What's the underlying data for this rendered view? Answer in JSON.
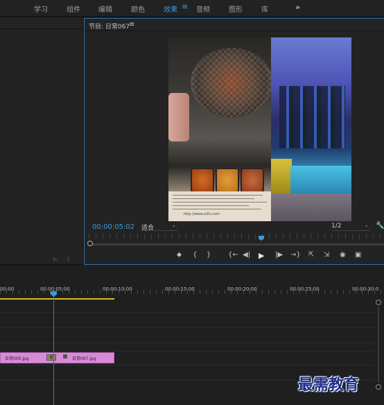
{
  "workspaces": [
    {
      "label": "学习",
      "active": false
    },
    {
      "label": "组件",
      "active": false
    },
    {
      "label": "编辑",
      "active": false
    },
    {
      "label": "颜色",
      "active": false
    },
    {
      "label": "效果",
      "active": true
    },
    {
      "label": "音频",
      "active": false
    },
    {
      "label": "图形",
      "active": false
    },
    {
      "label": "库",
      "active": false
    }
  ],
  "workspace_menu_icon": "≡",
  "workspace_more": "»",
  "program_monitor": {
    "title": "节目: 日常067",
    "menu_icon": "≡",
    "timecode": "00:00:05:02",
    "fit_label": "适合",
    "resolution_label": "1/2",
    "paper_url": "http://www.eiZu.com"
  },
  "transport_controls": [
    {
      "name": "add-marker-button",
      "glyph": "⬥"
    },
    {
      "name": "mark-in-button",
      "glyph": "{"
    },
    {
      "name": "mark-out-button",
      "glyph": "}"
    },
    {
      "name": "go-to-in-button",
      "glyph": "{←"
    },
    {
      "name": "step-back-button",
      "glyph": "◀|"
    },
    {
      "name": "play-button",
      "glyph": "▶"
    },
    {
      "name": "step-forward-button",
      "glyph": "|▶"
    },
    {
      "name": "go-to-out-button",
      "glyph": "→}"
    },
    {
      "name": "lift-button",
      "glyph": "⇱"
    },
    {
      "name": "extract-button",
      "glyph": "⇲"
    },
    {
      "name": "export-frame-button",
      "glyph": "◉"
    },
    {
      "name": "compare-view-button",
      "glyph": "▣"
    }
  ],
  "timeline": {
    "ruler_labels": [
      "00:00",
      "00:00:05:00",
      "00:00:10:00",
      "00:00:15:00",
      "00:00:20:00",
      "00:00:25:00",
      "00:00:30:0"
    ],
    "clips": [
      {
        "label": "日常000.jpg"
      },
      {
        "label": "日常067.jpg"
      }
    ],
    "transition_label": "视"
  },
  "watermark": "最需教育",
  "colors": {
    "accent": "#3a9be0",
    "clip": "#d98ad6",
    "work_area": "#d6c124"
  }
}
